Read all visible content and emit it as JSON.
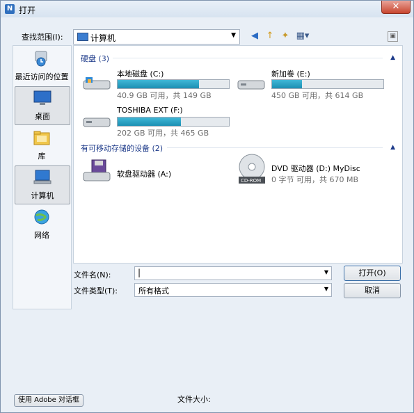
{
  "window": {
    "title": "打开"
  },
  "lookin": {
    "label": "查找范围(I):",
    "value": "计算机"
  },
  "places": [
    {
      "label": "最近访问的位置"
    },
    {
      "label": "桌面"
    },
    {
      "label": "库"
    },
    {
      "label": "计算机"
    },
    {
      "label": "网络"
    }
  ],
  "groups": {
    "hard_disks": {
      "title": "硬盘 (3)"
    },
    "removable": {
      "title": "有可移动存储的设备 (2)"
    }
  },
  "drives": [
    {
      "name": "本地磁盘 (C:)",
      "size": "40.9 GB 可用，共 149 GB",
      "used_fraction": 0.73
    },
    {
      "name": "新加卷 (E:)",
      "size": "450 GB 可用，共 614 GB",
      "used_fraction": 0.27
    },
    {
      "name": "TOSHIBA EXT (F:)",
      "size": "202 GB 可用，共 465 GB",
      "used_fraction": 0.57
    }
  ],
  "removable_devices": [
    {
      "name": "软盘驱动器 (A:)"
    },
    {
      "name": "DVD 驱动器 (D:) MyDisc",
      "size": "0 字节 可用，共 670 MB"
    }
  ],
  "filename": {
    "label": "文件名(N):",
    "value": ""
  },
  "filetype": {
    "label": "文件类型(T):",
    "value": "所有格式"
  },
  "buttons": {
    "open": "打开(O)",
    "cancel": "取消",
    "adobe": "使用 Adobe 对话框"
  },
  "filesize_label": "文件大小:",
  "icons": [
    "folder-up-icon",
    "new-folder-icon",
    "view-menu-icon",
    "back-icon",
    "preview-icon"
  ]
}
